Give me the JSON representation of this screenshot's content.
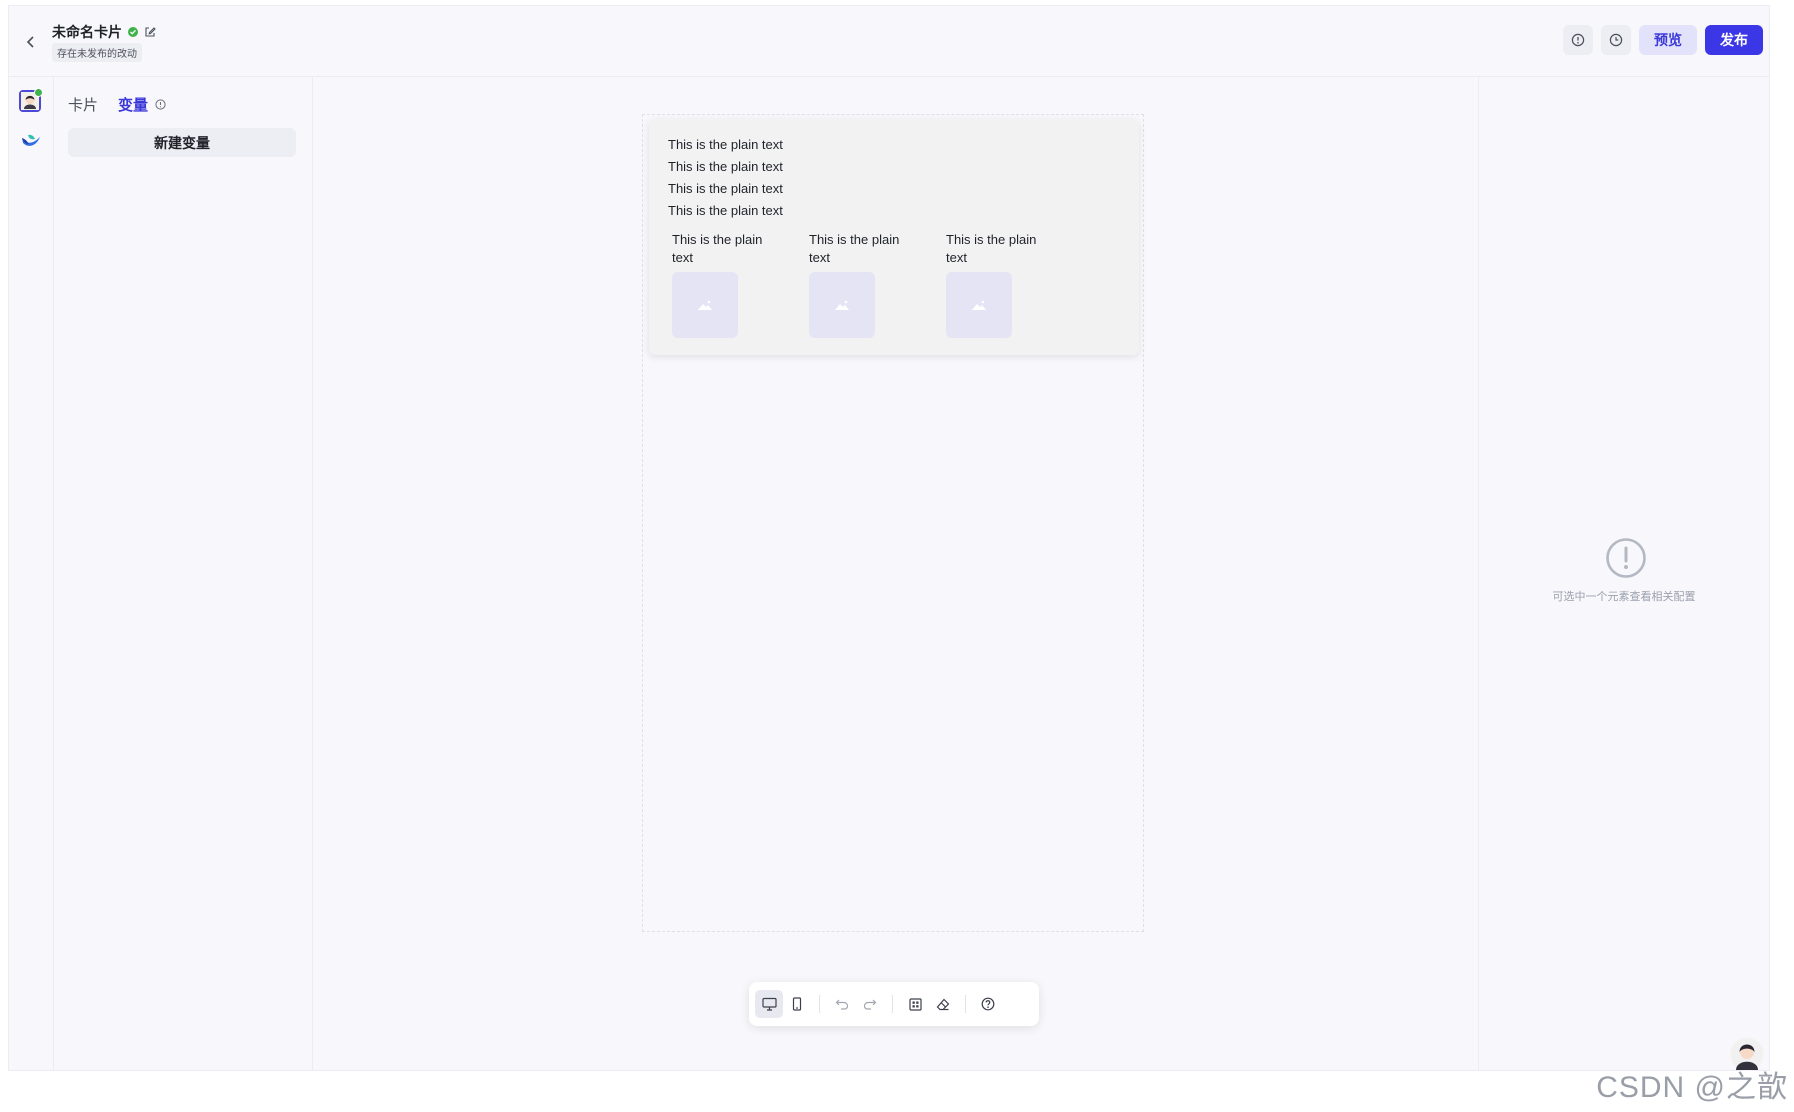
{
  "header": {
    "title": "未命名卡片",
    "status": "存在未发布的改动",
    "preview_label": "预览",
    "publish_label": "发布"
  },
  "left_panel": {
    "tabs": [
      {
        "label": "卡片",
        "active": false
      },
      {
        "label": "变量",
        "active": true
      }
    ],
    "new_variable_label": "新建变量"
  },
  "card": {
    "lines": [
      "This is the plain text",
      "This is the plain text",
      "This is the plain text",
      "This is the plain text"
    ],
    "columns": [
      {
        "text": "This is the plain text",
        "image": "image-placeholder-icon"
      },
      {
        "text": "This is the plain text",
        "image": "image-placeholder-icon"
      },
      {
        "text": "This is the plain text",
        "image": "image-placeholder-icon"
      }
    ]
  },
  "right_panel": {
    "empty_text": "可选中一个元素查看相关配置"
  },
  "watermark": "CSDN @之歆",
  "colors": {
    "accent": "#3b36e6",
    "accent_light": "#e2e3fb",
    "success": "#3fb24b",
    "background": "#f8f8fc"
  }
}
